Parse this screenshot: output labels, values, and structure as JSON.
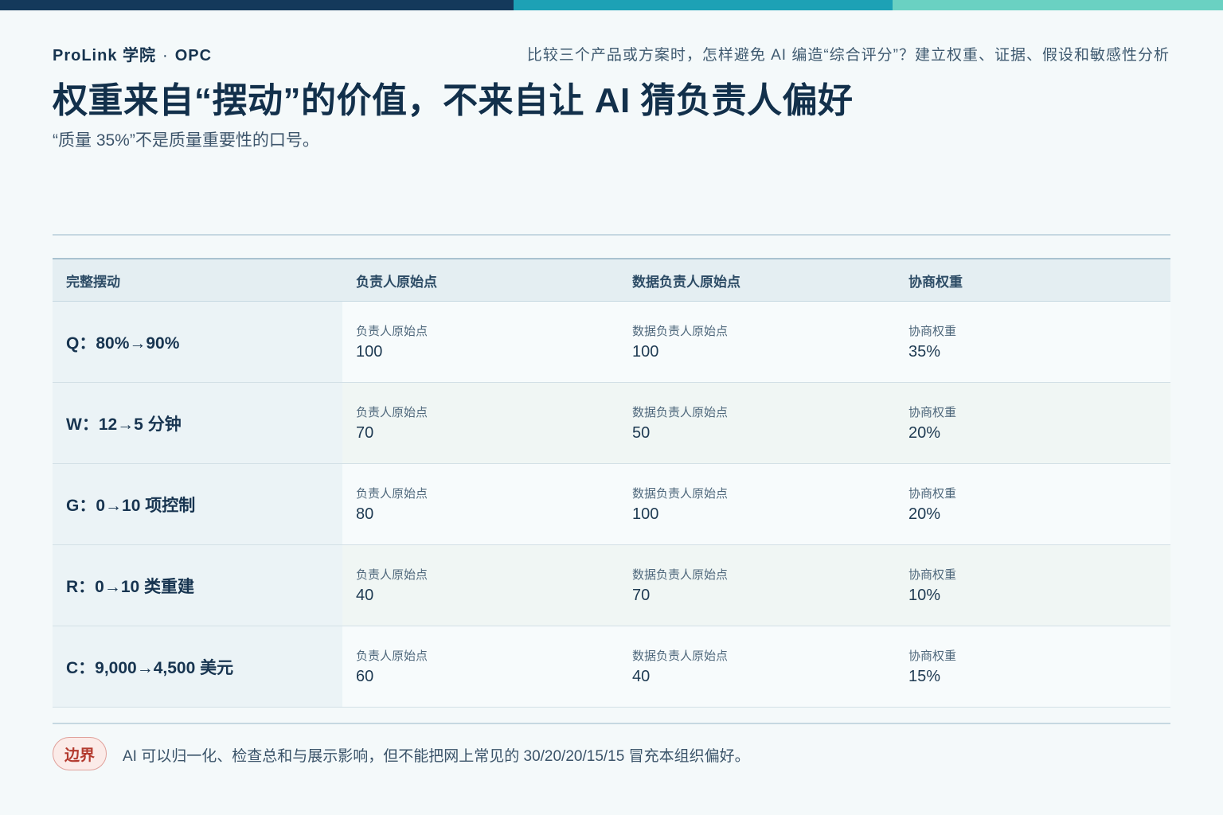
{
  "brand": {
    "name": "ProLink 学院",
    "separator": "·",
    "program": "OPC"
  },
  "subject": "比较三个产品或方案时，怎样避免 AI 编造“综合评分”？建立权重、证据、假设和敏感性分析",
  "headline": "权重来自“摆动”的价值，不来自让 AI 猜负责人偏好",
  "subhead": "“质量 35%”不是质量重要性的口号。",
  "table": {
    "headers": [
      "完整摆动",
      "负责人原始点",
      "数据负责人原始点",
      "协商权重"
    ],
    "cell_labels": {
      "owner": "负责人原始点",
      "data_owner": "数据负责人原始点",
      "weight": "协商权重"
    },
    "rows": [
      {
        "swing": "Q：80%→90%",
        "owner": "100",
        "data_owner": "100",
        "weight": "35%"
      },
      {
        "swing": "W：12→5 分钟",
        "owner": "70",
        "data_owner": "50",
        "weight": "20%"
      },
      {
        "swing": "G：0→10 项控制",
        "owner": "80",
        "data_owner": "100",
        "weight": "20%"
      },
      {
        "swing": "R：0→10 类重建",
        "owner": "40",
        "data_owner": "70",
        "weight": "10%"
      },
      {
        "swing": "C：9,000→4,500 美元",
        "owner": "60",
        "data_owner": "40",
        "weight": "15%"
      }
    ]
  },
  "boundary": {
    "tag": "边界",
    "text": "AI 可以归一化、检查总和与展示影响，但不能把网上常见的 30/20/20/15/15 冒充本组织偏好。"
  },
  "colors": {
    "navy": "#14395b",
    "teal": "#1da1b5",
    "mint": "#6ad1c2",
    "alert": "#b33a2e"
  }
}
